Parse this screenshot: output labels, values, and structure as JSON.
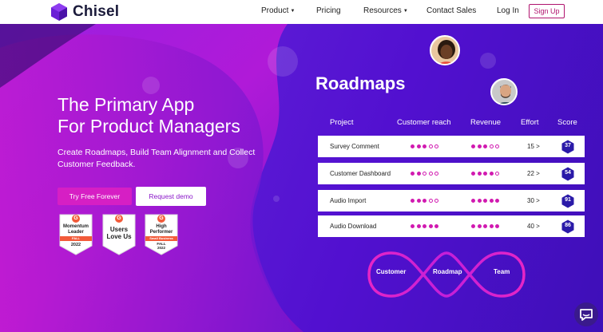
{
  "nav": {
    "brand": "Chisel",
    "items": [
      {
        "label": "Product",
        "dropdown": true
      },
      {
        "label": "Pricing",
        "dropdown": false
      },
      {
        "label": "Resources",
        "dropdown": true
      },
      {
        "label": "Contact Sales",
        "dropdown": false
      },
      {
        "label": "Log In",
        "dropdown": false
      }
    ],
    "signup": "Sign Up",
    "caret": "▼"
  },
  "hero": {
    "headline_line1": "The Primary App",
    "headline_line2": "For Product Managers",
    "subline": "Create Roadmaps, Build Team Alignment and Collect Customer Feedback.",
    "cta_primary": "Try Free Forever",
    "cta_secondary": "Request demo"
  },
  "badges": [
    {
      "lines": [
        "Momentum",
        "Leader"
      ],
      "ribbon": "FALL",
      "year": "2022",
      "g": "G"
    },
    {
      "lines": [
        "Users",
        "Love Us"
      ],
      "ribbon": "",
      "year": "",
      "g": "G"
    },
    {
      "lines": [
        "High",
        "Performer"
      ],
      "ribbon": "Small Business",
      "season": "FALL",
      "year": "2022",
      "g": "G"
    }
  ],
  "roadmap": {
    "title": "Roadmaps",
    "columns": [
      "Project",
      "Customer reach",
      "Revenue",
      "Effort",
      "Score"
    ],
    "rows": [
      {
        "project": "Survey Comment",
        "reach": 3,
        "revenue": 3,
        "effort": "15 >",
        "score": "37"
      },
      {
        "project": "Customer Dashboard",
        "reach": 2,
        "revenue": 4,
        "effort": "22 >",
        "score": "54"
      },
      {
        "project": "Audio Import",
        "reach": 3,
        "revenue": 5,
        "effort": "30 >",
        "score": "91"
      },
      {
        "project": "Audio Download",
        "reach": 5,
        "revenue": 5,
        "effort": "40 >",
        "score": "86"
      }
    ],
    "dots_total": 5
  },
  "loop": {
    "labels": [
      "Customer",
      "Roadmap",
      "Team"
    ]
  },
  "colors": {
    "accent": "#d61fc4",
    "hero_bg": "#5a19d4",
    "score_hex": "#2a1aa8",
    "dot": "#d11bb0"
  }
}
